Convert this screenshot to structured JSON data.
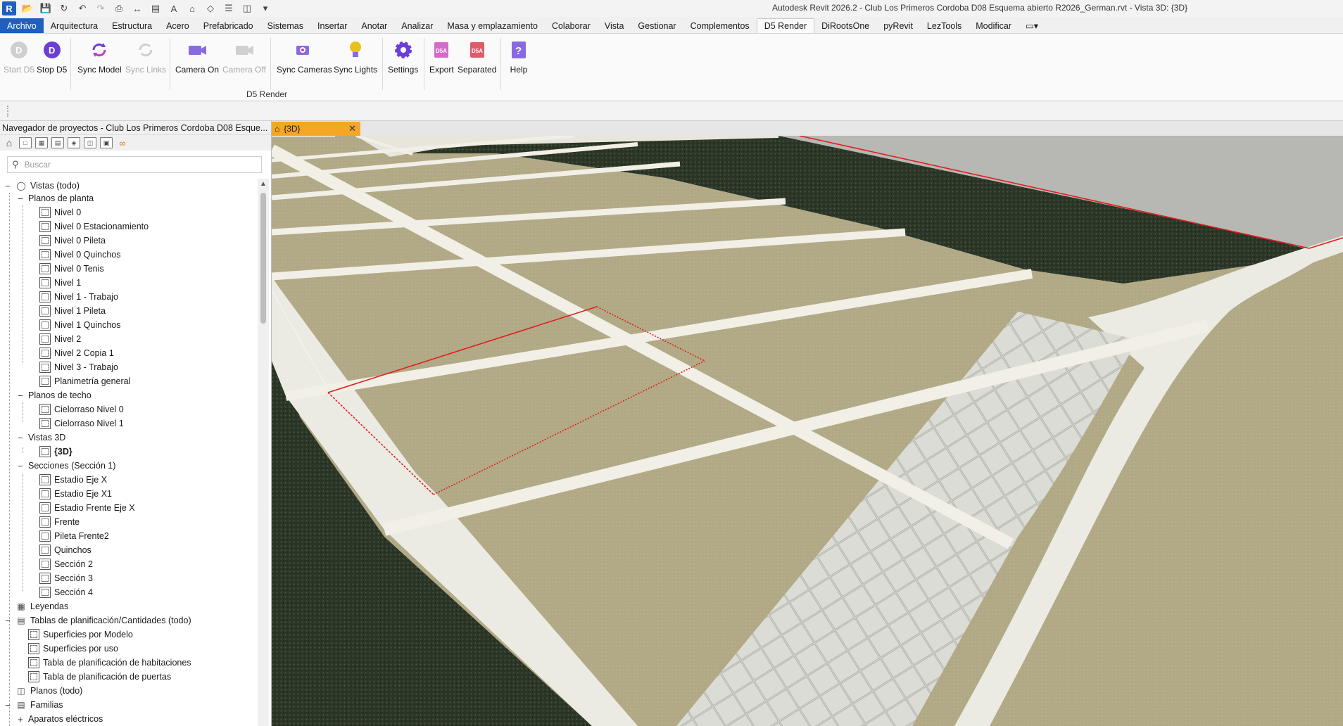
{
  "titlebar": {
    "app_logo": "R",
    "window_title": "Autodesk Revit 2026.2 - Club Los Primeros Cordoba D08 Esquema abierto R2026_German.rvt - Vista 3D: {3D}",
    "qat_icons": [
      "open-icon",
      "save-icon",
      "sync-icon",
      "undo-icon",
      "redo-icon",
      "print-icon",
      "measure-icon",
      "align-icon",
      "text-icon",
      "home-view-icon",
      "section-box-icon",
      "thin-lines-icon",
      "close-windows-icon",
      "dropdown-icon"
    ]
  },
  "ribbon": {
    "tabs": [
      "Archivo",
      "Arquitectura",
      "Estructura",
      "Acero",
      "Prefabricado",
      "Sistemas",
      "Insertar",
      "Anotar",
      "Analizar",
      "Masa y emplazamiento",
      "Colaborar",
      "Vista",
      "Gestionar",
      "Complementos",
      "D5 Render",
      "DiRootsOne",
      "pyRevit",
      "LezTools",
      "Modificar"
    ],
    "active_tab": "D5 Render",
    "buttons": {
      "start_d5": "Start D5",
      "stop_d5": "Stop D5",
      "sync_model": "Sync Model",
      "sync_links": "Sync Links",
      "camera_on": "Camera On",
      "camera_off": "Camera Off",
      "sync_cameras": "Sync Cameras",
      "sync_lights": "Sync Lights",
      "settings": "Settings",
      "export": "Export",
      "separated": "Separated",
      "help": "Help"
    },
    "panel_label": "D5 Render",
    "colors": {
      "archivo_bg": "#1f5fbf",
      "d5_purple": "#6b3fd6"
    }
  },
  "browser": {
    "title": "Navegador de proyectos - Club Los Primeros Cordoba D08 Esque...",
    "search_placeholder": "Buscar",
    "tree": {
      "vistas": "Vistas (todo)",
      "planos_planta": "Planos de planta",
      "planta_items": [
        "Nivel 0",
        "Nivel 0 Estacionamiento",
        "Nivel 0 Pileta",
        "Nivel 0 Quinchos",
        "Nivel 0 Tenis",
        "Nivel 1",
        "Nivel 1 - Trabajo",
        "Nivel 1 Pileta",
        "Nivel 1 Quinchos",
        "Nivel 2",
        "Nivel 2 Copia 1",
        "Nivel 3 - Trabajo",
        "Planimetría general"
      ],
      "planos_techo": "Planos de techo",
      "techo_items": [
        "Cielorraso Nivel 0",
        "Cielorraso Nivel 1"
      ],
      "vistas_3d": "Vistas 3D",
      "vistas_3d_items": [
        "{3D}"
      ],
      "secciones": "Secciones (Sección 1)",
      "secciones_items": [
        "Estadio Eje X",
        "Estadio Eje X1",
        "Estadio Frente Eje X",
        "Frente",
        "Pileta Frente2",
        "Quinchos",
        "Sección 2",
        "Sección 3",
        "Sección 4"
      ],
      "leyendas": "Leyendas",
      "tablas": "Tablas de planificación/Cantidades (todo)",
      "tablas_items": [
        "Superficies por Modelo",
        "Superficies por uso",
        "Tabla de planificación de habitaciones",
        "Tabla de planificación de puertas"
      ],
      "planos": "Planos (todo)",
      "familias": "Familias",
      "aparatos": "Aparatos eléctricos"
    }
  },
  "view": {
    "tab_label": "{3D}",
    "tab_color": "#f5a623",
    "colors": {
      "grass": "#2f3a2b",
      "paving": "#b5ad8a",
      "concrete": "#b9b9b9",
      "selection": "#e02020"
    }
  }
}
